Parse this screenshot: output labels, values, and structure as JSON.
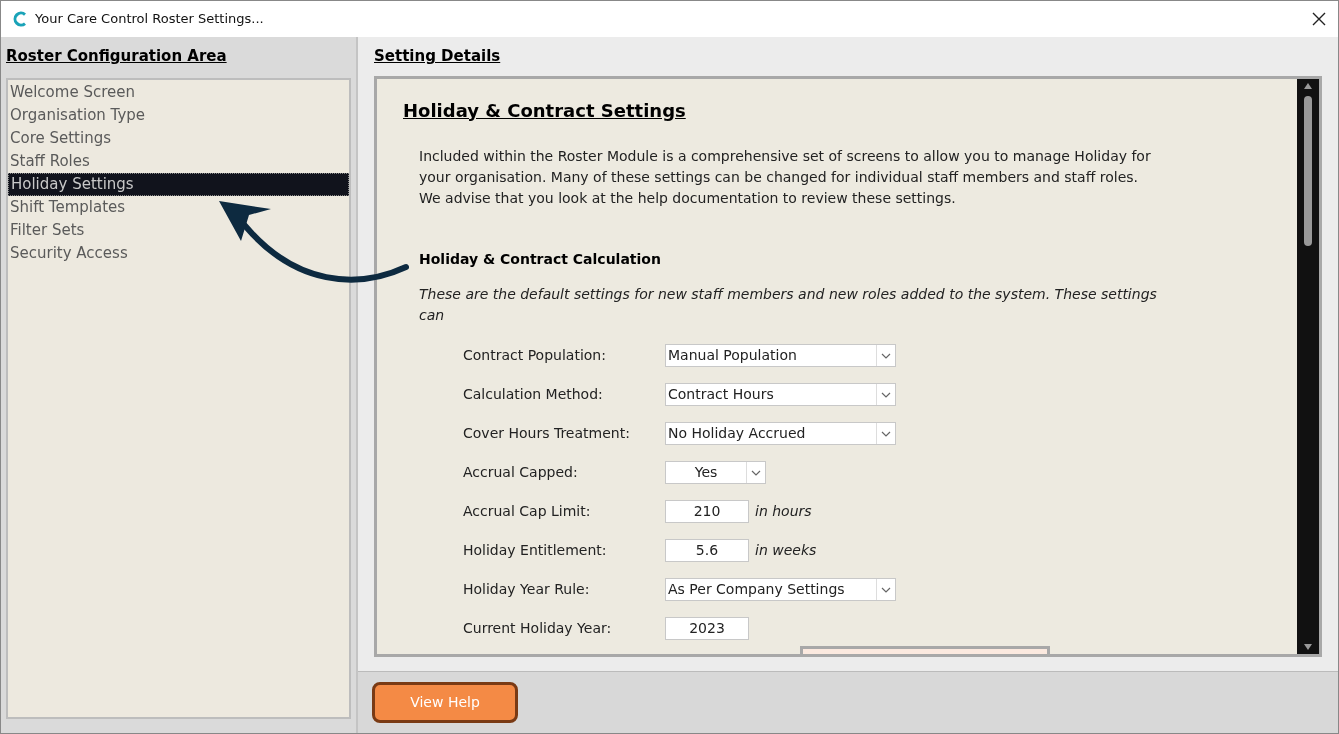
{
  "window": {
    "title": "Your Care Control Roster Settings..."
  },
  "sidebar": {
    "heading": "Roster Configuration Area",
    "items": [
      {
        "label": "Welcome Screen",
        "selected": false
      },
      {
        "label": "Organisation Type",
        "selected": false
      },
      {
        "label": "Core Settings",
        "selected": false
      },
      {
        "label": "Staff Roles",
        "selected": false
      },
      {
        "label": "Holiday Settings",
        "selected": true
      },
      {
        "label": "Shift Templates",
        "selected": false
      },
      {
        "label": "Filter Sets",
        "selected": false
      },
      {
        "label": "Security Access",
        "selected": false
      }
    ]
  },
  "details": {
    "heading": "Setting Details",
    "title": "Holiday & Contract Settings",
    "intro": "Included within the Roster Module is a comprehensive set of screens to allow you to manage Holiday for your organisation.   Many of these settings can be changed for individual staff members and staff roles.  We advise that you look at the help documentation to review these settings.",
    "section_title": "Holiday & Contract Calculation",
    "section_note": "These are the default settings for new staff members and new roles added to the system.  These settings can",
    "fields": [
      {
        "kind": "select",
        "label": "Contract Population:",
        "value": "Manual Population"
      },
      {
        "kind": "select",
        "label": "Calculation Method:",
        "value": "Contract Hours"
      },
      {
        "kind": "select",
        "label": "Cover Hours Treatment:",
        "value": "No Holiday Accrued"
      },
      {
        "kind": "small-select",
        "label": "Accrual Capped:",
        "value": "Yes"
      },
      {
        "kind": "input",
        "label": "Accrual Cap Limit:",
        "value": "210",
        "suffix": "in hours"
      },
      {
        "kind": "input",
        "label": "Holiday Entitlement:",
        "value": "5.6",
        "suffix": "in weeks"
      },
      {
        "kind": "select",
        "label": "Holiday Year Rule:",
        "value": "As Per Company Settings"
      },
      {
        "kind": "input",
        "label": "Current Holiday Year:",
        "value": "2023"
      }
    ]
  },
  "footer": {
    "help_button": "View Help"
  }
}
